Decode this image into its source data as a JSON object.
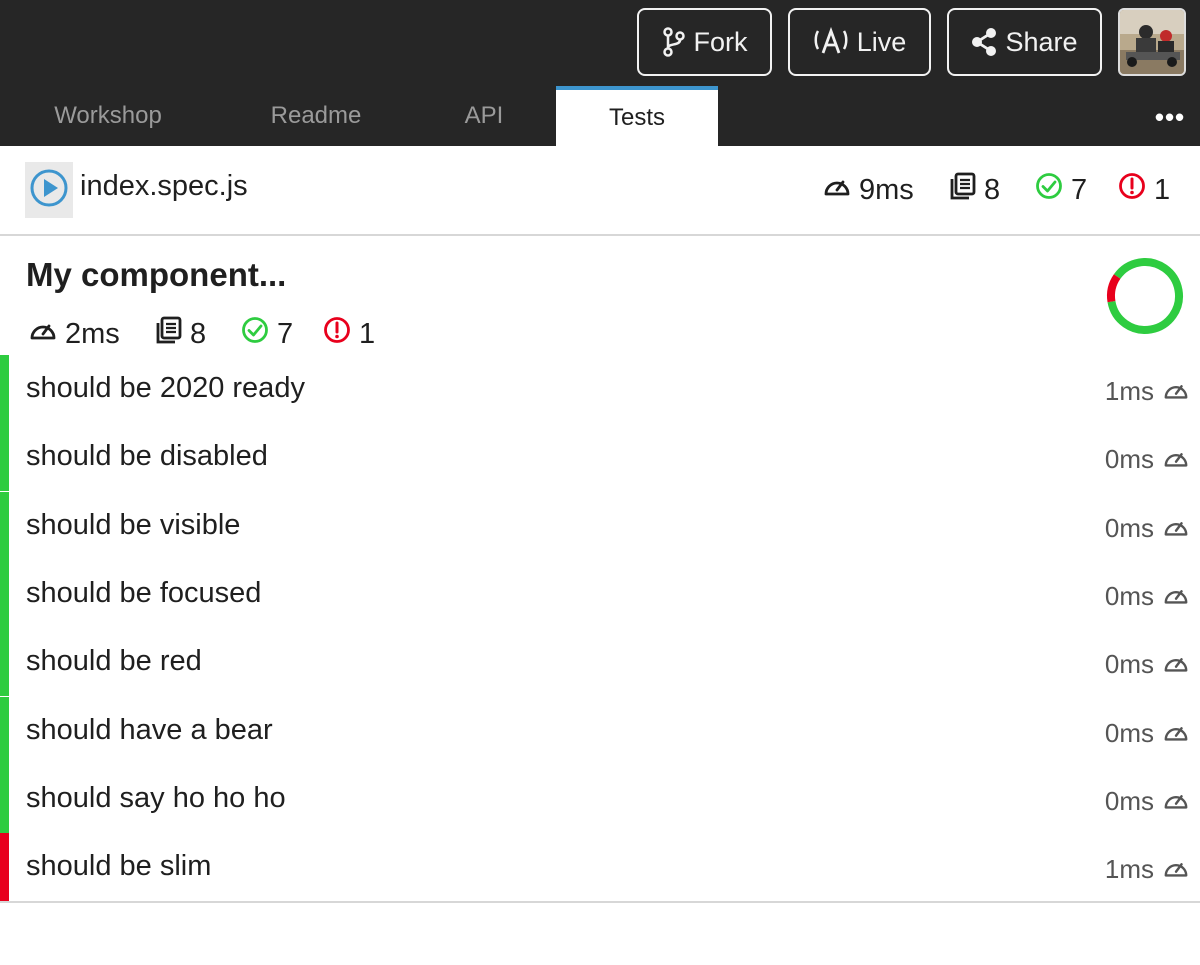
{
  "toolbar": {
    "fork_label": "Fork",
    "live_label": "Live",
    "share_label": "Share"
  },
  "tabs": [
    {
      "label": "Workshop",
      "active": false
    },
    {
      "label": "Readme",
      "active": false
    },
    {
      "label": "API",
      "active": false
    },
    {
      "label": "Tests",
      "active": true
    }
  ],
  "more_label": "•••",
  "file": {
    "name": "index.spec.js",
    "duration": "9ms",
    "total": "8",
    "passed": "7",
    "failed": "1"
  },
  "suite": {
    "title": "My component...",
    "duration": "2ms",
    "total": "8",
    "passed": "7",
    "failed": "1",
    "pass_fraction": 0.875
  },
  "tests": [
    {
      "name": "should be 2020 ready",
      "time": "1ms",
      "status": "passed"
    },
    {
      "name": "should be disabled",
      "time": "0ms",
      "status": "passed"
    },
    {
      "name": "should be visible",
      "time": "0ms",
      "status": "passed"
    },
    {
      "name": "should be focused",
      "time": "0ms",
      "status": "passed"
    },
    {
      "name": "should be red",
      "time": "0ms",
      "status": "passed"
    },
    {
      "name": "should have a bear",
      "time": "0ms",
      "status": "passed"
    },
    {
      "name": "should say ho ho ho",
      "time": "0ms",
      "status": "passed"
    },
    {
      "name": "should be slim",
      "time": "1ms",
      "status": "failed"
    }
  ],
  "colors": {
    "pass": "#2ecc40",
    "fail": "#e8001c",
    "accent": "#3d95ce",
    "topbar": "#262626"
  },
  "icons": {
    "fork": "git-branch-icon",
    "live": "broadcast-icon",
    "share": "share-icon",
    "play": "play-circle-icon",
    "duration": "speedometer-icon",
    "total": "tests-list-icon",
    "passed": "check-circle-icon",
    "failed": "exclamation-circle-icon"
  }
}
